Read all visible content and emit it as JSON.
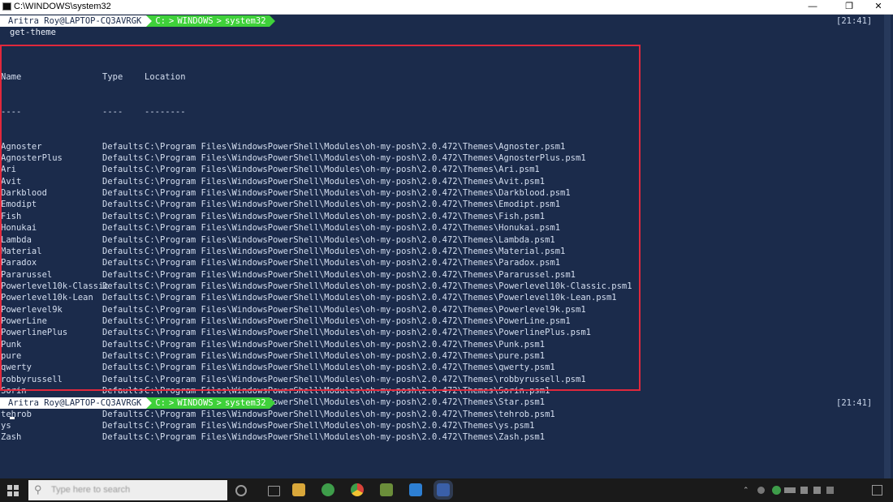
{
  "window": {
    "title": "C:\\WINDOWS\\system32",
    "minimize_glyph": "—",
    "maximize_glyph": "❐",
    "close_glyph": "✕"
  },
  "prompt": {
    "user": "Aritra Roy@LAPTOP-CQ3AVRGK",
    "drive": "C:",
    "folder1": "WINDOWS",
    "folder2": "system32",
    "separator": ">",
    "time": "[21:41]"
  },
  "command": "get-theme",
  "table": {
    "headers": {
      "name": "Name",
      "type": "Type",
      "location": "Location"
    },
    "underlines": {
      "name": "----",
      "type": "----",
      "location": "--------"
    },
    "rows": [
      {
        "name": "Agnoster",
        "type": "Defaults",
        "location": "C:\\Program Files\\WindowsPowerShell\\Modules\\oh-my-posh\\2.0.472\\Themes\\Agnoster.psm1"
      },
      {
        "name": "AgnosterPlus",
        "type": "Defaults",
        "location": "C:\\Program Files\\WindowsPowerShell\\Modules\\oh-my-posh\\2.0.472\\Themes\\AgnosterPlus.psm1"
      },
      {
        "name": "Ari",
        "type": "Defaults",
        "location": "C:\\Program Files\\WindowsPowerShell\\Modules\\oh-my-posh\\2.0.472\\Themes\\Ari.psm1"
      },
      {
        "name": "Avit",
        "type": "Defaults",
        "location": "C:\\Program Files\\WindowsPowerShell\\Modules\\oh-my-posh\\2.0.472\\Themes\\Avit.psm1"
      },
      {
        "name": "Darkblood",
        "type": "Defaults",
        "location": "C:\\Program Files\\WindowsPowerShell\\Modules\\oh-my-posh\\2.0.472\\Themes\\Darkblood.psm1"
      },
      {
        "name": "Emodipt",
        "type": "Defaults",
        "location": "C:\\Program Files\\WindowsPowerShell\\Modules\\oh-my-posh\\2.0.472\\Themes\\Emodipt.psm1"
      },
      {
        "name": "Fish",
        "type": "Defaults",
        "location": "C:\\Program Files\\WindowsPowerShell\\Modules\\oh-my-posh\\2.0.472\\Themes\\Fish.psm1"
      },
      {
        "name": "Honukai",
        "type": "Defaults",
        "location": "C:\\Program Files\\WindowsPowerShell\\Modules\\oh-my-posh\\2.0.472\\Themes\\Honukai.psm1"
      },
      {
        "name": "Lambda",
        "type": "Defaults",
        "location": "C:\\Program Files\\WindowsPowerShell\\Modules\\oh-my-posh\\2.0.472\\Themes\\Lambda.psm1"
      },
      {
        "name": "Material",
        "type": "Defaults",
        "location": "C:\\Program Files\\WindowsPowerShell\\Modules\\oh-my-posh\\2.0.472\\Themes\\Material.psm1"
      },
      {
        "name": "Paradox",
        "type": "Defaults",
        "location": "C:\\Program Files\\WindowsPowerShell\\Modules\\oh-my-posh\\2.0.472\\Themes\\Paradox.psm1"
      },
      {
        "name": "Pararussel",
        "type": "Defaults",
        "location": "C:\\Program Files\\WindowsPowerShell\\Modules\\oh-my-posh\\2.0.472\\Themes\\Pararussel.psm1"
      },
      {
        "name": "Powerlevel10k-Classic",
        "type": "Defaults",
        "location": "C:\\Program Files\\WindowsPowerShell\\Modules\\oh-my-posh\\2.0.472\\Themes\\Powerlevel10k-Classic.psm1"
      },
      {
        "name": "Powerlevel10k-Lean",
        "type": "Defaults",
        "location": "C:\\Program Files\\WindowsPowerShell\\Modules\\oh-my-posh\\2.0.472\\Themes\\Powerlevel10k-Lean.psm1"
      },
      {
        "name": "Powerlevel9k",
        "type": "Defaults",
        "location": "C:\\Program Files\\WindowsPowerShell\\Modules\\oh-my-posh\\2.0.472\\Themes\\Powerlevel9k.psm1"
      },
      {
        "name": "PowerLine",
        "type": "Defaults",
        "location": "C:\\Program Files\\WindowsPowerShell\\Modules\\oh-my-posh\\2.0.472\\Themes\\PowerLine.psm1"
      },
      {
        "name": "PowerlinePlus",
        "type": "Defaults",
        "location": "C:\\Program Files\\WindowsPowerShell\\Modules\\oh-my-posh\\2.0.472\\Themes\\PowerlinePlus.psm1"
      },
      {
        "name": "Punk",
        "type": "Defaults",
        "location": "C:\\Program Files\\WindowsPowerShell\\Modules\\oh-my-posh\\2.0.472\\Themes\\Punk.psm1"
      },
      {
        "name": "pure",
        "type": "Defaults",
        "location": "C:\\Program Files\\WindowsPowerShell\\Modules\\oh-my-posh\\2.0.472\\Themes\\pure.psm1"
      },
      {
        "name": "qwerty",
        "type": "Defaults",
        "location": "C:\\Program Files\\WindowsPowerShell\\Modules\\oh-my-posh\\2.0.472\\Themes\\qwerty.psm1"
      },
      {
        "name": "robbyrussell",
        "type": "Defaults",
        "location": "C:\\Program Files\\WindowsPowerShell\\Modules\\oh-my-posh\\2.0.472\\Themes\\robbyrussell.psm1"
      },
      {
        "name": "Sorin",
        "type": "Defaults",
        "location": "C:\\Program Files\\WindowsPowerShell\\Modules\\oh-my-posh\\2.0.472\\Themes\\Sorin.psm1"
      },
      {
        "name": "Star",
        "type": "Defaults",
        "location": "C:\\Program Files\\WindowsPowerShell\\Modules\\oh-my-posh\\2.0.472\\Themes\\Star.psm1"
      },
      {
        "name": "tehrob",
        "type": "Defaults",
        "location": "C:\\Program Files\\WindowsPowerShell\\Modules\\oh-my-posh\\2.0.472\\Themes\\tehrob.psm1"
      },
      {
        "name": "ys",
        "type": "Defaults",
        "location": "C:\\Program Files\\WindowsPowerShell\\Modules\\oh-my-posh\\2.0.472\\Themes\\ys.psm1"
      },
      {
        "name": "Zash",
        "type": "Defaults",
        "location": "C:\\Program Files\\WindowsPowerShell\\Modules\\oh-my-posh\\2.0.472\\Themes\\Zash.psm1"
      }
    ]
  },
  "taskbar": {
    "search_placeholder": "Type here to search"
  },
  "colors": {
    "background": "#1b2b4b",
    "prompt_user_bg": "#ffffff",
    "prompt_path_bg": "#3fd13a",
    "highlight_border": "#e0283c",
    "text": "#d5dff0"
  },
  "icons": {
    "app": "terminal-app-icon",
    "start": "windows-start-icon",
    "search": "search-icon"
  }
}
